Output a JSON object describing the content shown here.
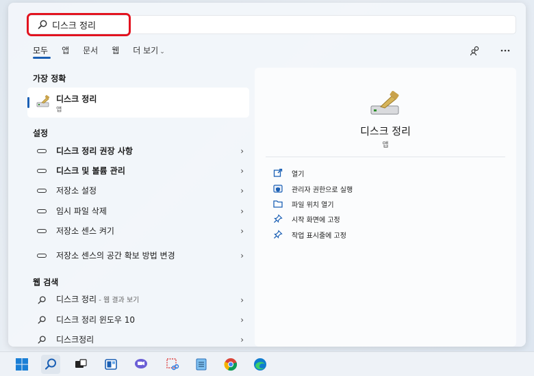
{
  "search": {
    "query": "디스크 정리"
  },
  "tabs": [
    {
      "label": "모두"
    },
    {
      "label": "앱"
    },
    {
      "label": "문서"
    },
    {
      "label": "웹"
    },
    {
      "label": "더 보기"
    }
  ],
  "left": {
    "best_match_title": "가장 정확",
    "best_match": {
      "name": "디스크 정리",
      "kind": "앱"
    },
    "settings_title": "설정",
    "settings": [
      {
        "label": "디스크 정리 권장 사항"
      },
      {
        "label": "디스크 및 볼륨 관리"
      },
      {
        "label": "저장소 설정"
      },
      {
        "label": "임시 파일 삭제"
      },
      {
        "label": "저장소 센스 켜기"
      },
      {
        "label": "저장소 센스의 공간 확보 방법 변경"
      }
    ],
    "web_title": "웹 검색",
    "web": [
      {
        "label": "디스크 정리",
        "suffix": " - 웹 결과 보기"
      },
      {
        "label": "디스크 정리 윈도우 10",
        "suffix": ""
      },
      {
        "label": "디스크정리",
        "suffix": ""
      }
    ]
  },
  "right": {
    "app_name": "디스크 정리",
    "app_kind": "앱",
    "actions": [
      {
        "label": "열기",
        "icon": "open-icon"
      },
      {
        "label": "관리자 권한으로 실행",
        "icon": "shield-icon"
      },
      {
        "label": "파일 위치 열기",
        "icon": "folder-icon"
      },
      {
        "label": "시작 화면에 고정",
        "icon": "pin-icon"
      },
      {
        "label": "작업 표시줄에 고정",
        "icon": "pin-icon"
      }
    ]
  },
  "colors": {
    "accent": "#1a5fb4",
    "highlight": "#e2131f"
  }
}
